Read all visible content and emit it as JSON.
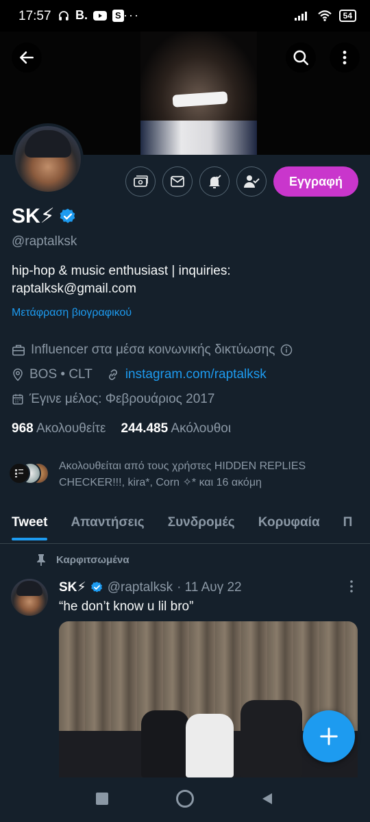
{
  "status_bar": {
    "time": "17:57",
    "app_icons": [
      "headphones-icon",
      "B.",
      "youtube-icon",
      "S"
    ],
    "b_label": "B.",
    "s_label": "S",
    "more": "···",
    "battery": "54"
  },
  "profile": {
    "name": "SK⚡",
    "handle": "@raptalksk",
    "bio_line1": "hip-hop & music enthusiast | inquiries:",
    "bio_line2": "raptalksk@gmail.com",
    "translate_bio": "Μετάφραση βιογραφικού",
    "category": "Influencer στα μέσα κοινωνικής δικτύωσης",
    "location": "BOS • CLT",
    "website": "instagram.com/raptalksk",
    "joined": "Έγινε μέλος: Φεβρουάριος 2017",
    "following_count": "968",
    "following_label": "Ακολουθείτε",
    "followers_count": "244.485",
    "followers_label": "Ακόλουθοι",
    "followed_by_line1": "Ακολουθείται από τους χρήστες HIDDEN REPLIES",
    "followed_by_line2": "CHECKER!!!, kira*, Corn ✧* και 16 ακόμη",
    "subscribe_label": "Εγγραφή"
  },
  "tabs": [
    {
      "label": "Tweet",
      "active": true
    },
    {
      "label": "Απαντήσεις",
      "active": false
    },
    {
      "label": "Συνδρομές",
      "active": false
    },
    {
      "label": "Κορυφαία",
      "active": false
    },
    {
      "label": "Π",
      "active": false
    }
  ],
  "pinned_tweet": {
    "pinned_label": "Καρφιτσωμένα",
    "author_name": "SK⚡",
    "author_handle": "@raptalksk",
    "date": "· 11 Αυγ 22",
    "text": "“he don’t know u lil bro”"
  },
  "colors": {
    "background": "#15202b",
    "accent_blue": "#1d9bf0",
    "subscribe_purple": "#c936cc",
    "secondary_text": "#8b98a5"
  }
}
